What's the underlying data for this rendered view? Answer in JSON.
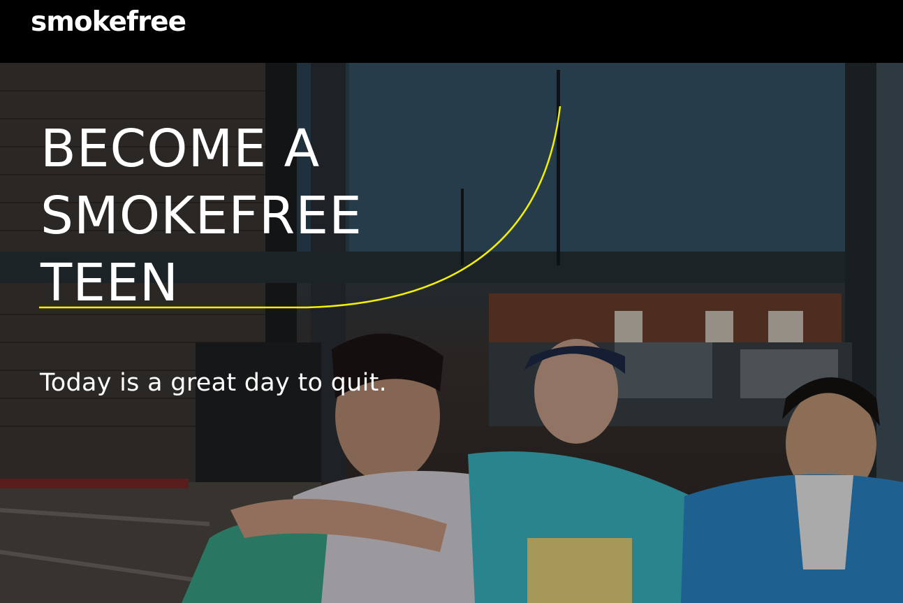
{
  "header": {
    "logo_text": "smokefree"
  },
  "hero": {
    "headline_lines": [
      "BECOME A",
      "SMOKEFREE",
      "TEEN"
    ],
    "subtitle": "Today is a great day to quit.",
    "accent_color": "#f2f000",
    "image": "photo of three teenagers sitting in front of a storefront window"
  }
}
